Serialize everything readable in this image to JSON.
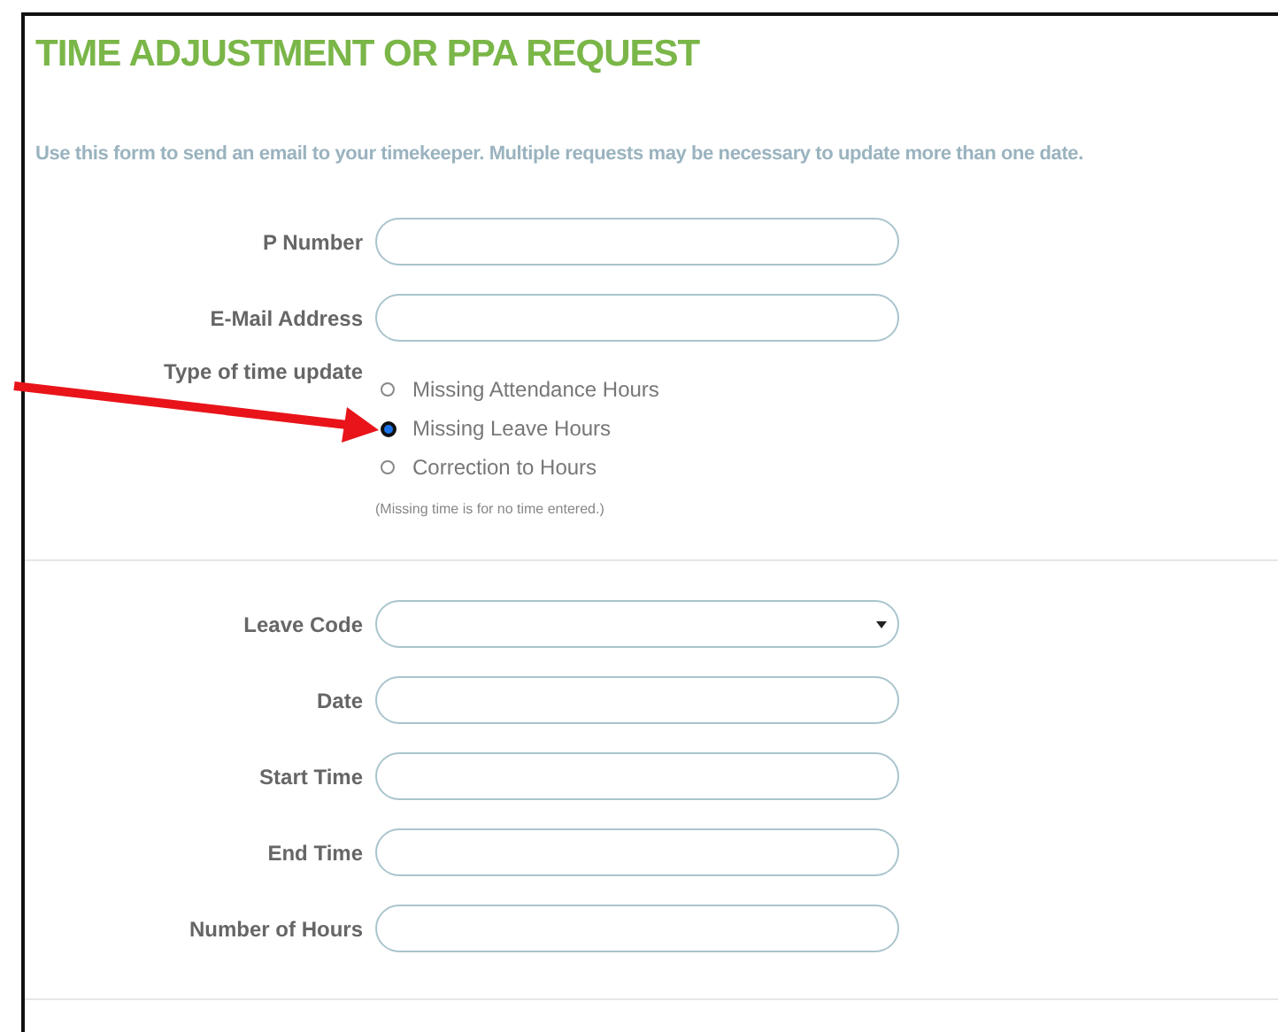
{
  "title": "TIME ADJUSTMENT OR PPA REQUEST",
  "description": "Use this form to send an email to your timekeeper. Multiple requests may be necessary to update more than one date.",
  "section_1": {
    "fields": [
      {
        "label": "P Number"
      },
      {
        "label": "E-Mail Address"
      }
    ],
    "radio_group": {
      "label": "Type of time update",
      "options": [
        {
          "label": "Missing Attendance Hours",
          "selected": false
        },
        {
          "label": "Missing Leave Hours",
          "selected": true
        },
        {
          "label": "Correction to Hours",
          "selected": false
        }
      ],
      "note": "(Missing time is for no time entered.)"
    }
  },
  "section_2": {
    "fields": [
      {
        "label": "Leave Code",
        "kind": "select"
      },
      {
        "label": "Date",
        "kind": "text"
      },
      {
        "label": "Start Time",
        "kind": "text"
      },
      {
        "label": "End Time",
        "kind": "text"
      },
      {
        "label": "Number of Hours",
        "kind": "text"
      }
    ]
  }
}
